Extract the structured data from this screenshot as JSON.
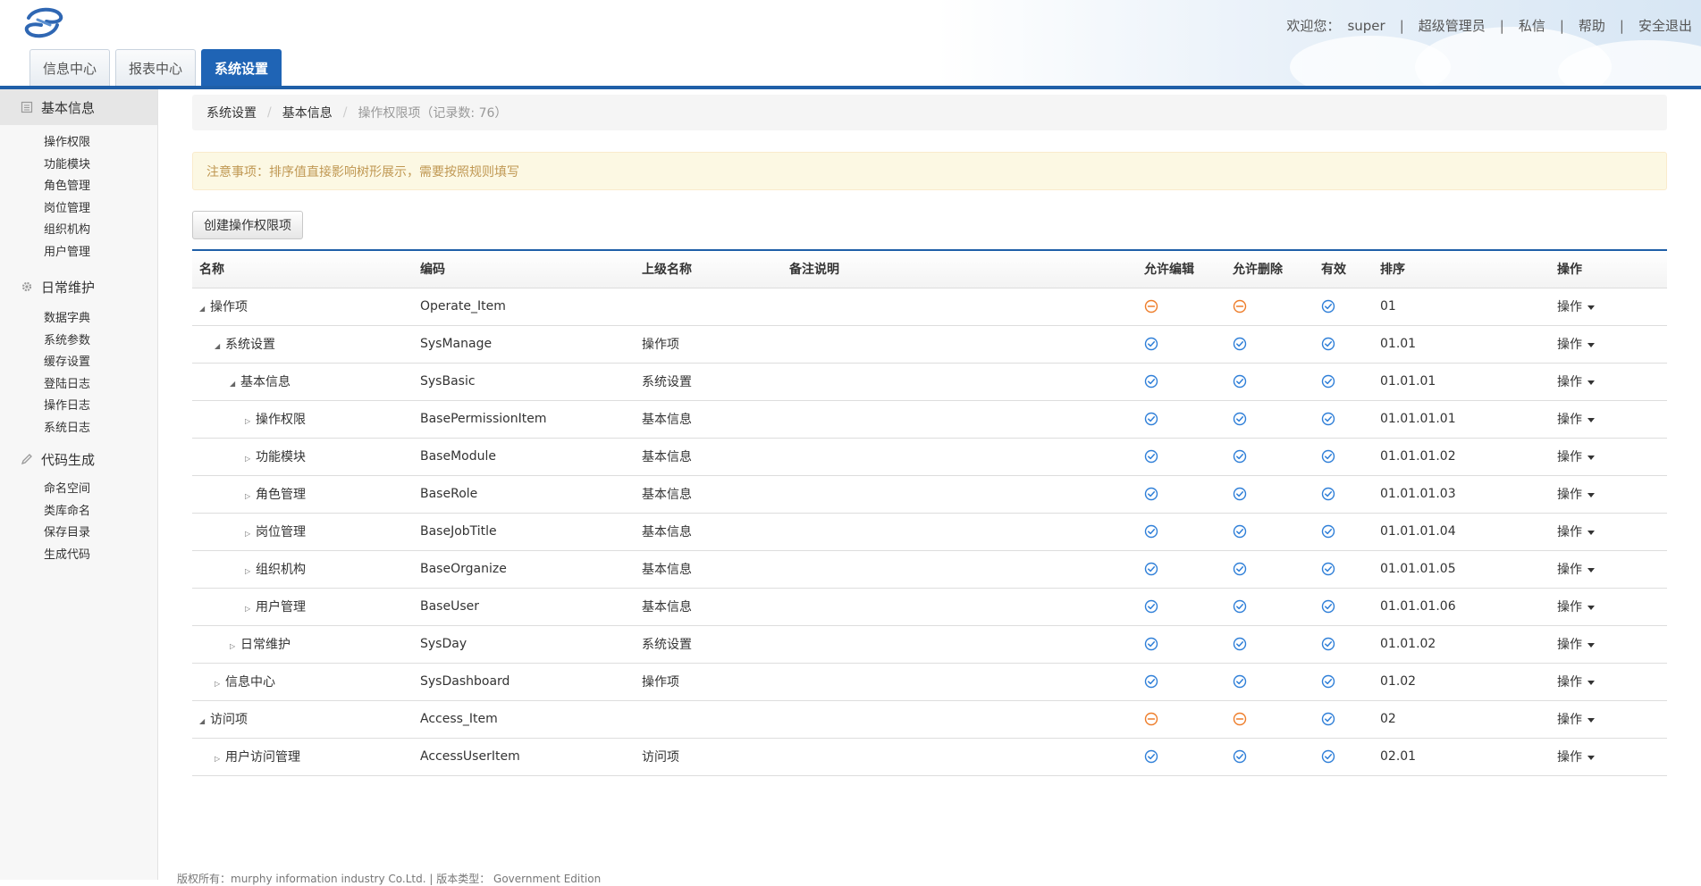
{
  "header": {
    "welcome": "欢迎您：",
    "username": "super",
    "role": "超级管理员",
    "messages": "私信",
    "help": "帮助",
    "logout": "安全退出"
  },
  "tabs": [
    {
      "label": "信息中心",
      "active": false
    },
    {
      "label": "报表中心",
      "active": false
    },
    {
      "label": "系统设置",
      "active": true
    }
  ],
  "sidebar": {
    "groups": [
      {
        "label": "基本信息",
        "icon": "list-icon",
        "items": [
          "操作权限",
          "功能模块",
          "角色管理",
          "岗位管理",
          "组织机构",
          "用户管理"
        ]
      },
      {
        "label": "日常维护",
        "icon": "gear-icon",
        "items": [
          "数据字典",
          "系统参数",
          "缓存设置",
          "登陆日志",
          "操作日志",
          "系统日志"
        ]
      },
      {
        "label": "代码生成",
        "icon": "pencil-icon",
        "items": [
          "命名空间",
          "类库命名",
          "保存目录",
          "生成代码"
        ]
      }
    ]
  },
  "breadcrumb": {
    "items": [
      "系统设置",
      "基本信息"
    ],
    "current": "操作权限项（记录数: 76）"
  },
  "notice": "注意事项：排序值直接影响树形展示，需要按照规则填写",
  "create_button": "创建操作权限项",
  "table": {
    "columns": [
      "名称",
      "编码",
      "上级名称",
      "备注说明",
      "允许编辑",
      "允许删除",
      "有效",
      "排序",
      "操作"
    ],
    "action_label": "操作",
    "rows": [
      {
        "level": 0,
        "expanded": true,
        "name": "操作项",
        "code": "Operate_Item",
        "parent": "",
        "note": "",
        "edit": false,
        "delete": false,
        "valid": true,
        "sort": "01"
      },
      {
        "level": 1,
        "expanded": true,
        "name": "系统设置",
        "code": "SysManage",
        "parent": "操作项",
        "note": "",
        "edit": true,
        "delete": true,
        "valid": true,
        "sort": "01.01"
      },
      {
        "level": 2,
        "expanded": true,
        "name": "基本信息",
        "code": "SysBasic",
        "parent": "系统设置",
        "note": "",
        "edit": true,
        "delete": true,
        "valid": true,
        "sort": "01.01.01"
      },
      {
        "level": 3,
        "expanded": false,
        "name": "操作权限",
        "code": "BasePermissionItem",
        "parent": "基本信息",
        "note": "",
        "edit": true,
        "delete": true,
        "valid": true,
        "sort": "01.01.01.01"
      },
      {
        "level": 3,
        "expanded": false,
        "name": "功能模块",
        "code": "BaseModule",
        "parent": "基本信息",
        "note": "",
        "edit": true,
        "delete": true,
        "valid": true,
        "sort": "01.01.01.02"
      },
      {
        "level": 3,
        "expanded": false,
        "name": "角色管理",
        "code": "BaseRole",
        "parent": "基本信息",
        "note": "",
        "edit": true,
        "delete": true,
        "valid": true,
        "sort": "01.01.01.03"
      },
      {
        "level": 3,
        "expanded": false,
        "name": "岗位管理",
        "code": "BaseJobTitle",
        "parent": "基本信息",
        "note": "",
        "edit": true,
        "delete": true,
        "valid": true,
        "sort": "01.01.01.04"
      },
      {
        "level": 3,
        "expanded": false,
        "name": "组织机构",
        "code": "BaseOrganize",
        "parent": "基本信息",
        "note": "",
        "edit": true,
        "delete": true,
        "valid": true,
        "sort": "01.01.01.05"
      },
      {
        "level": 3,
        "expanded": false,
        "name": "用户管理",
        "code": "BaseUser",
        "parent": "基本信息",
        "note": "",
        "edit": true,
        "delete": true,
        "valid": true,
        "sort": "01.01.01.06"
      },
      {
        "level": 2,
        "expanded": false,
        "name": "日常维护",
        "code": "SysDay",
        "parent": "系统设置",
        "note": "",
        "edit": true,
        "delete": true,
        "valid": true,
        "sort": "01.01.02"
      },
      {
        "level": 1,
        "expanded": false,
        "name": "信息中心",
        "code": "SysDashboard",
        "parent": "操作项",
        "note": "",
        "edit": true,
        "delete": true,
        "valid": true,
        "sort": "01.02"
      },
      {
        "level": 0,
        "expanded": true,
        "name": "访问项",
        "code": "Access_Item",
        "parent": "",
        "note": "",
        "edit": false,
        "delete": false,
        "valid": true,
        "sort": "02"
      },
      {
        "level": 1,
        "expanded": false,
        "name": "用户访问管理",
        "code": "AccessUserItem",
        "parent": "访问项",
        "note": "",
        "edit": true,
        "delete": true,
        "valid": true,
        "sort": "02.01"
      }
    ]
  },
  "footer": "版权所有：murphy information industry Co.Ltd. | 版本类型： Government Edition",
  "colors": {
    "brand_blue": "#1f5fa8",
    "active_tab": "#1f64b5",
    "check_blue": "#2f7fd8",
    "forbid_orange": "#ee7d2a",
    "notice_text": "#c09853"
  }
}
